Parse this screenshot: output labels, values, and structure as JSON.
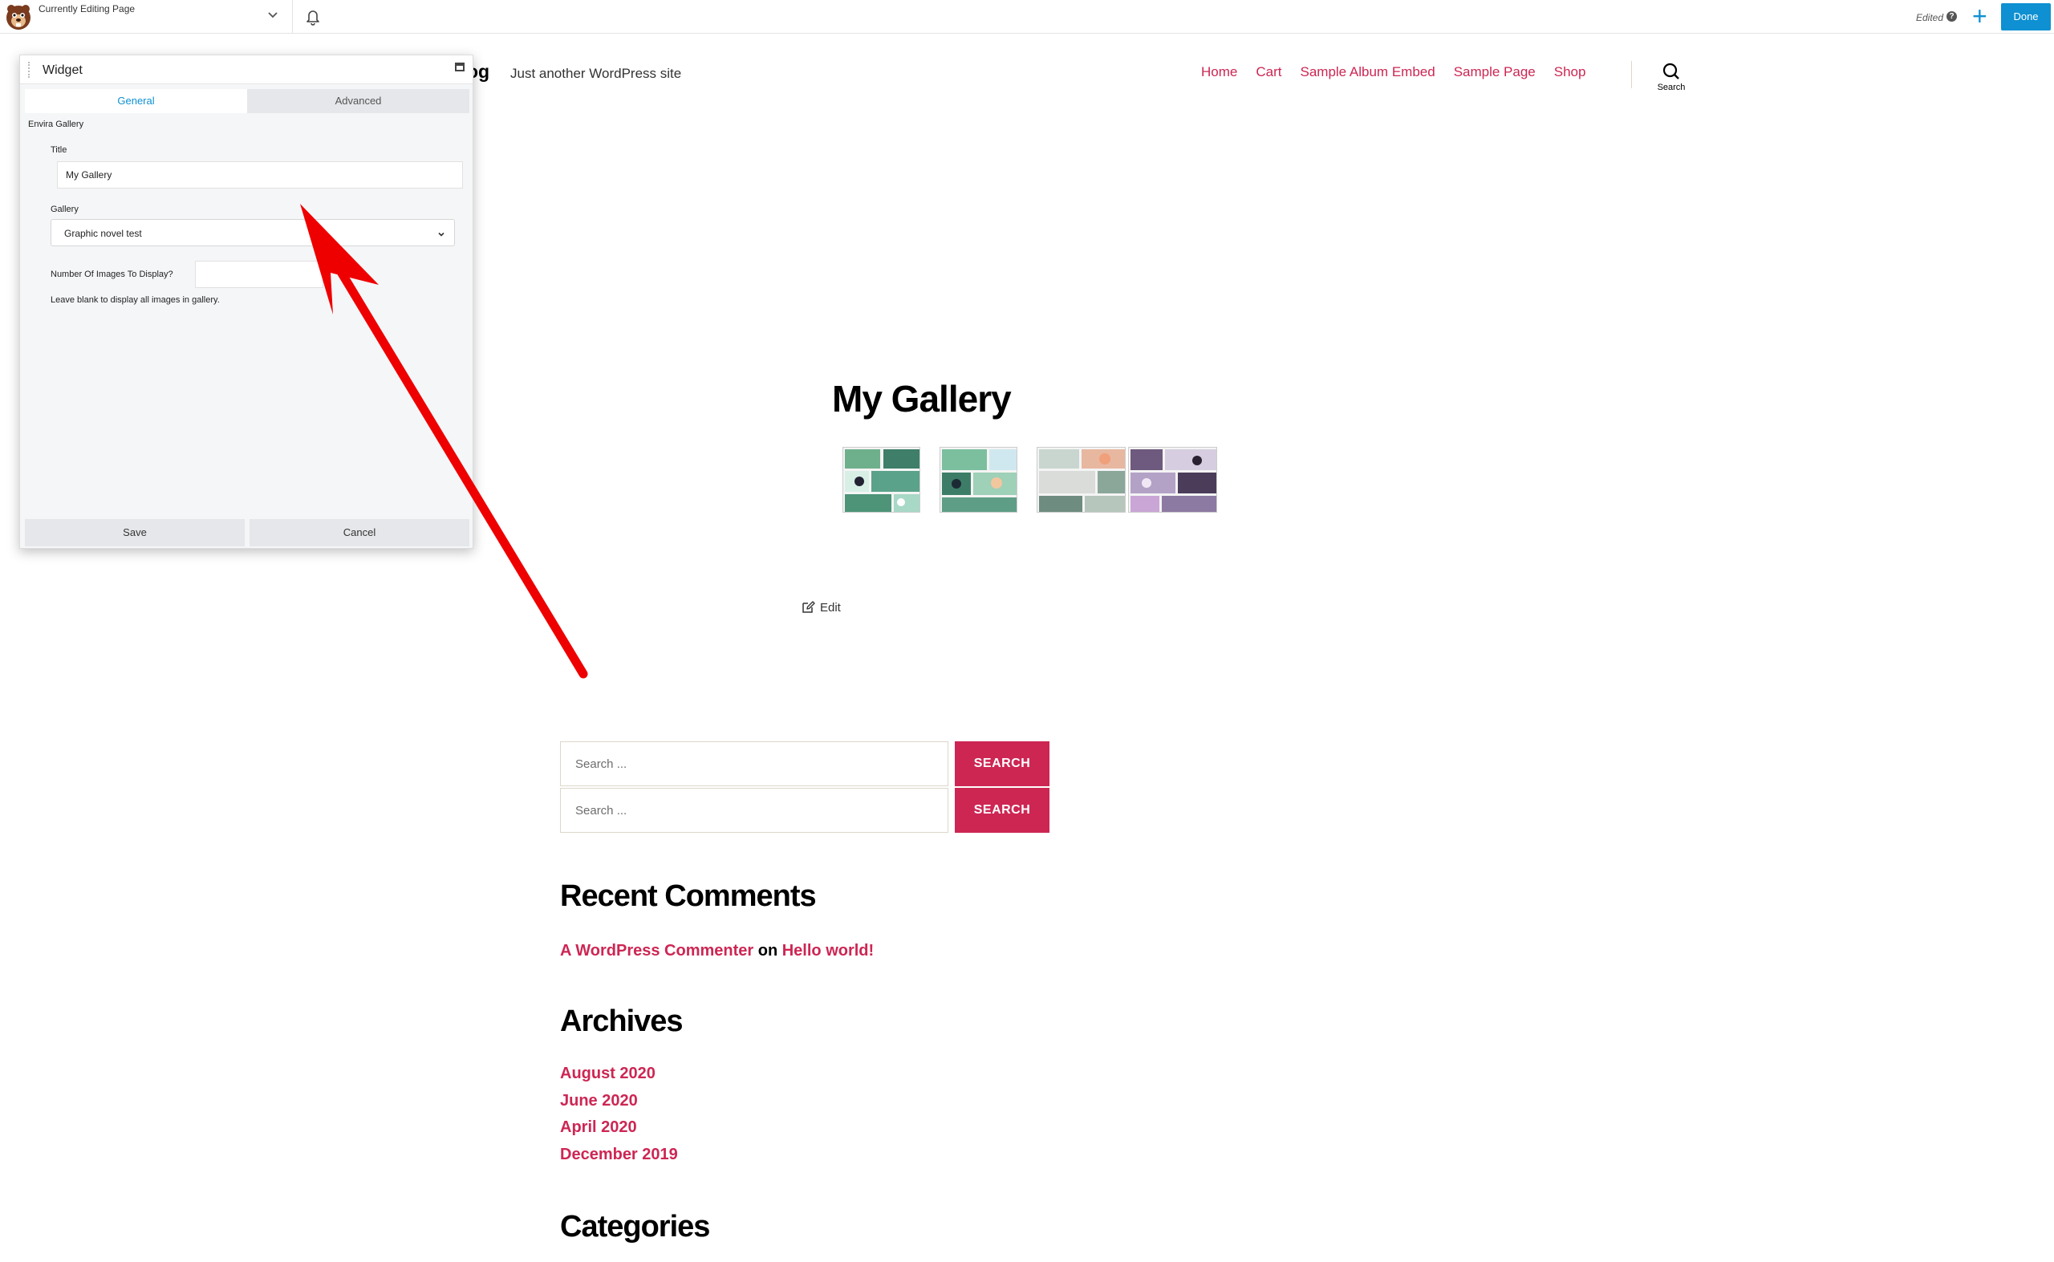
{
  "topbar": {
    "editing_label": "Currently Editing Page",
    "edited_label": "Edited",
    "help_glyph": "?",
    "add_glyph": "+",
    "done_label": "Done"
  },
  "site": {
    "title_fragment": "og",
    "tagline": "Just another WordPress site",
    "nav": [
      "Home",
      "Cart",
      "Sample Album Embed",
      "Sample Page",
      "Shop"
    ],
    "search_label": "Search"
  },
  "widget_panel": {
    "title": "Widget",
    "tabs": {
      "general": "General",
      "advanced": "Advanced"
    },
    "section": "Envira Gallery",
    "title_label": "Title",
    "title_value": "My Gallery",
    "gallery_label": "Gallery",
    "gallery_value": "Graphic novel test",
    "num_label": "Number Of Images To Display?",
    "num_value": "",
    "help_text": "Leave blank to display all images in gallery.",
    "save_label": "Save",
    "cancel_label": "Cancel"
  },
  "content": {
    "gallery_title": "My Gallery",
    "thumbnail_count": 4,
    "edit_label": "Edit"
  },
  "sidebar": {
    "search_forms": [
      {
        "placeholder": "Search ...",
        "button": "SEARCH"
      },
      {
        "placeholder": "Search ...",
        "button": "SEARCH"
      }
    ],
    "recent_comments": {
      "heading": "Recent Comments",
      "author": "A WordPress Commenter",
      "connector": "on",
      "post": "Hello world!"
    },
    "archives": {
      "heading": "Archives",
      "items": [
        "August 2020",
        "June 2020",
        "April 2020",
        "December 2019"
      ]
    },
    "categories": {
      "heading": "Categories"
    }
  },
  "colors": {
    "accent": "#cd2653",
    "editor_blue": "#0e90d2",
    "arrow": "#ee0000"
  }
}
